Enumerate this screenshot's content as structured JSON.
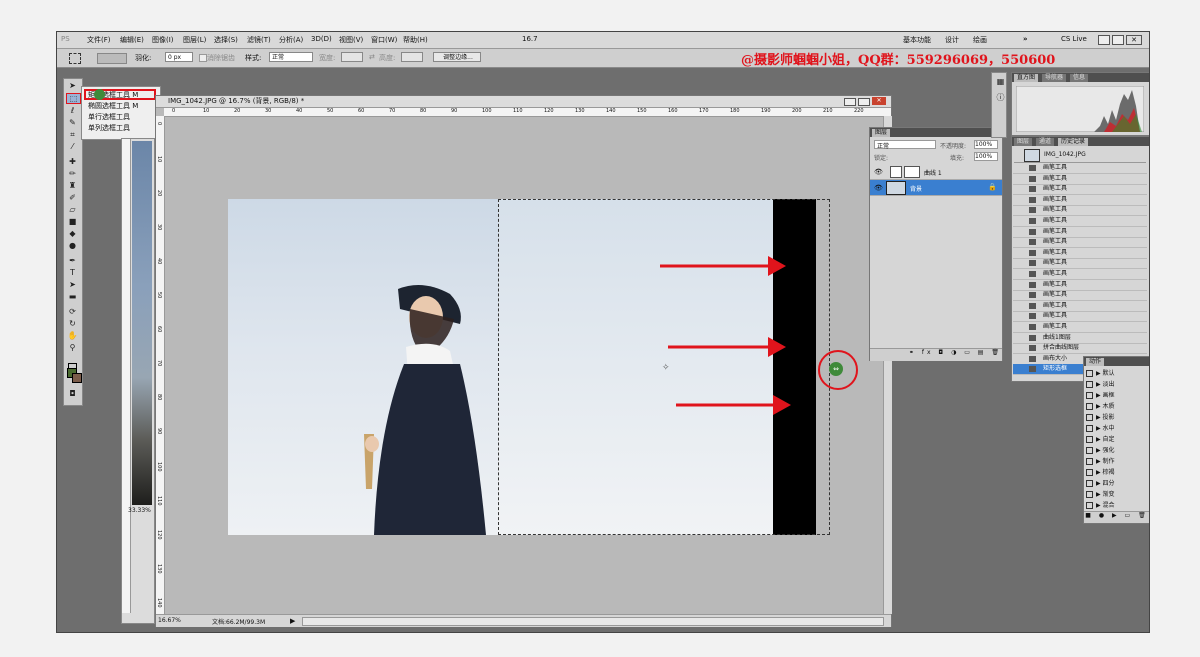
{
  "app": {
    "logo": "PS"
  },
  "menu": [
    "文件(F)",
    "编辑(E)",
    "图像(I)",
    "图层(L)",
    "选择(S)",
    "滤镜(T)",
    "分析(A)",
    "3D(D)",
    "视图(V)",
    "窗口(W)",
    "帮助(H)"
  ],
  "appbar": {
    "zoom": "16.7",
    "workspace": [
      "基本功能",
      "设计",
      "绘画"
    ],
    "more": "»",
    "cslive": "CS Live"
  },
  "options": {
    "feather_label": "羽化:",
    "feather_value": "0 px",
    "antialias": "消除锯齿",
    "style_label": "样式:",
    "style_value": "正常",
    "width_label": "宽度:",
    "height_label": "高度:",
    "refine_edge": "调整边缘..."
  },
  "watermark": "@摄影师蝈蝈小姐，QQ群：559296069，550600",
  "flyout": [
    "矩形选框工具 M",
    "椭圆选框工具 M",
    "单行选框工具",
    "单列选框工具"
  ],
  "document": {
    "title": "IMG_1042.JPG @ 16.7% (背景, RGB/8) *",
    "zoom": "16.67%",
    "doc_size": "文档:66.2M/99.3M",
    "ruler_top": [
      "0",
      "10",
      "20",
      "30",
      "40",
      "50",
      "60",
      "70",
      "80",
      "90",
      "100",
      "110",
      "120",
      "130",
      "140",
      "150",
      "160",
      "170",
      "180",
      "190",
      "200",
      "210",
      "220"
    ],
    "ruler_left": [
      "0",
      "10",
      "20",
      "30",
      "40",
      "50",
      "60",
      "70",
      "80",
      "90",
      "100",
      "110",
      "120",
      "130",
      "140"
    ]
  },
  "second_doc": {
    "zoom": "33.33%"
  },
  "layers": {
    "tab": "图层",
    "blend_mode": "正常",
    "opacity_label": "不透明度:",
    "opacity": "100%",
    "lock_label": "锁定:",
    "fill_label": "填充:",
    "fill": "100%",
    "items": [
      {
        "name": "曲线 1"
      },
      {
        "name": "背景"
      }
    ]
  },
  "navigator": {
    "tabs": [
      "直方图",
      "导航器",
      "信息"
    ]
  },
  "history": {
    "tabs": [
      "图层",
      "通道",
      "历史记录"
    ],
    "snapshot": "IMG_1042.JPG",
    "items": [
      "画笔工具",
      "画笔工具",
      "画笔工具",
      "画笔工具",
      "画笔工具",
      "画笔工具",
      "画笔工具",
      "画笔工具",
      "画笔工具",
      "画笔工具",
      "画笔工具",
      "画笔工具",
      "画笔工具",
      "画笔工具",
      "画笔工具",
      "画笔工具",
      "曲线1图层",
      "拼合曲线图层",
      "画布大小",
      "矩形选框"
    ]
  },
  "actions": {
    "tab": "动作",
    "items": [
      "默认",
      "淡出",
      "画框",
      "木质",
      "投影",
      "水中",
      "自定",
      "强化",
      "制作",
      "棕褐",
      "四分",
      "渐变",
      "混合"
    ]
  },
  "colors": {
    "highlight": "#e0141c",
    "selected": "#3a7fd0",
    "canvas_bg": "#b9b9b9",
    "fg": "#4a6a30",
    "bg": "#7b5c4a"
  }
}
